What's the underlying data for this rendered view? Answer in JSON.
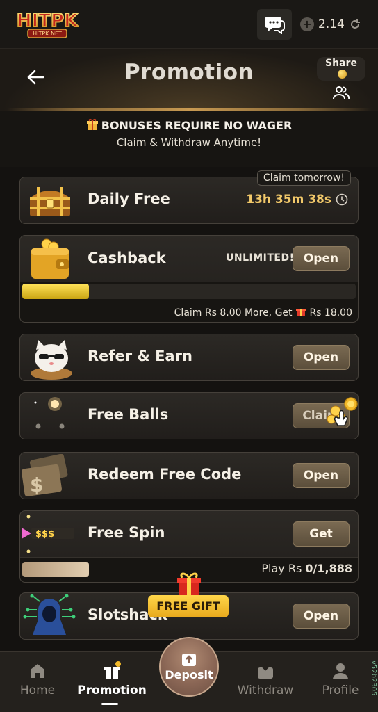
{
  "app": {
    "logo_text": "HITPK",
    "logo_subtext": "HITPK.NET"
  },
  "topbar": {
    "balance": "2.14"
  },
  "header": {
    "title": "Promotion",
    "share_label": "Share"
  },
  "notice": {
    "line1": "BONUSES REQUIRE NO WAGER",
    "line2": "Claim & Withdraw Anytime!"
  },
  "cards": {
    "daily_free": {
      "title": "Daily Free",
      "badge": "Claim tomorrow!",
      "timer": "13h 35m 38s"
    },
    "cashback": {
      "title": "Cashback",
      "tag": "UNLIMITED!",
      "button": "Open",
      "progress": 0.2,
      "hint_prefix": "Claim Rs 8.00 More, Get",
      "hint_amount": "Rs 18.00"
    },
    "refer": {
      "title": "Refer & Earn",
      "button": "Open"
    },
    "free_balls": {
      "title": "Free Balls",
      "button": "Claim"
    },
    "redeem": {
      "title": "Redeem Free Code",
      "button": "Open",
      "icon_symbol": "$"
    },
    "free_spin": {
      "title": "Free Spin",
      "button": "Get",
      "icon_text": "$$$",
      "progress_label": "Play Rs",
      "progress_value": "0/1,888",
      "progress": 0.2
    },
    "slotshack": {
      "title": "Slotshack",
      "button": "Open"
    }
  },
  "free_gift": {
    "label": "FREE GIFT"
  },
  "bottom_nav": {
    "home": "Home",
    "promotion": "Promotion",
    "deposit": "Deposit",
    "withdraw": "Withdraw",
    "profile": "Profile"
  },
  "version": "v52b2305",
  "colors": {
    "accent_gold": "#f2c96a",
    "button_brown": "#6a5b46",
    "free_gift_yellow": "#ffd64a"
  }
}
